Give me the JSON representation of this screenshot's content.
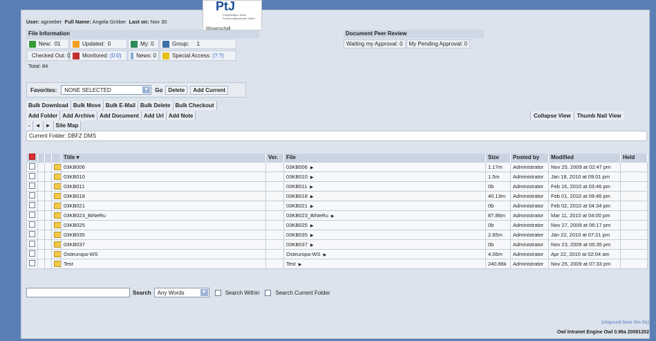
{
  "header": {
    "user_label": "User:",
    "user_value": "agroeber",
    "fullname_label": "Full Name:",
    "fullname_value": "Angela Gröber",
    "lastone_label": "Last on:",
    "lastone_value": "Nov 30"
  },
  "logo": {
    "mark": "PtJ",
    "sub": "Projektträger Jülich Forschungszentrum Jülich",
    "cut": "Wissenschaft"
  },
  "file_info": {
    "title": "File Information",
    "new_label": "New:",
    "new_value": "01",
    "updated_label": "Updated:",
    "updated_value": "0",
    "my_label": "My:",
    "my_value": "0",
    "group_label": "Group:",
    "group_value": "1",
    "checkedout_label": "Checked Out:",
    "checkedout_value": "0",
    "monitored_label": "Monitored:",
    "monitored_value": "(0:0)",
    "news_label": "News:",
    "news_value": "0",
    "special_label": "Special Access:",
    "special_value": "(?:?)",
    "total": "Total: 84"
  },
  "peer_review": {
    "title": "Document Peer Review",
    "waiting": "Waiting my Approval: 0",
    "pending": "My Pending Approval: 0"
  },
  "favorites": {
    "label": "Favorites:",
    "selected": "NONE SELECTED",
    "go": "Go",
    "delete": "Delete",
    "add_current": "Add Current"
  },
  "bulk_bar": [
    "Bulk Download",
    "Bulk Move",
    "Bulk E-Mail",
    "Bulk Delete",
    "Bulk Checkout"
  ],
  "add_bar": [
    "Add Folder",
    "Add Archive",
    "Add Document",
    "Add Url",
    "Add Note"
  ],
  "view_bar": [
    "Collapse View",
    "Thumb Nail View"
  ],
  "nav_bar": {
    "back": "-",
    "prev": "◄",
    "next": "►",
    "sitemap": "Site Map"
  },
  "current_folder": "Current Folder: DBFZ DMS",
  "table": {
    "headers": {
      "title": "Title ▾",
      "ver": "Ver.",
      "file": "File",
      "size": "Size",
      "posted": "Posted by",
      "modified": "Modified",
      "held": "Held"
    },
    "rows": [
      {
        "title": "03KB006",
        "file": "03KB006",
        "size": "1.17m",
        "posted": "Administrator",
        "modified": "Nov 25, 2009 at 02:47 pm"
      },
      {
        "title": "03KB010",
        "file": "03KB010",
        "size": "1.5m",
        "posted": "Administrator",
        "modified": "Jan 18, 2010 at 09:01 pm"
      },
      {
        "title": "03KB011",
        "file": "03KB011",
        "size": "0b",
        "posted": "Administrator",
        "modified": "Feb 16, 2010 at 03:46 pm"
      },
      {
        "title": "03KB018",
        "file": "03KB018",
        "size": "40.13m",
        "posted": "Administrator",
        "modified": "Feb 01, 2010 at 09:46 pm"
      },
      {
        "title": "03KB021",
        "file": "03KB021",
        "size": "0b",
        "posted": "Administrator",
        "modified": "Feb 02, 2010 at 04:34 pm"
      },
      {
        "title": "03KB023_BiNeRu",
        "file": "03KB023_BiNeRu",
        "size": "87.86m",
        "posted": "Administrator",
        "modified": "Mar 11, 2010 at 04:00 pm"
      },
      {
        "title": "03KB025",
        "file": "03KB025",
        "size": "0b",
        "posted": "Administrator",
        "modified": "Nov 27, 2009 at 06:17 pm"
      },
      {
        "title": "03KB035",
        "file": "03KB035",
        "size": "2.65m",
        "posted": "Administrator",
        "modified": "Jan 22, 2010 at 07:21 pm"
      },
      {
        "title": "03KB037",
        "file": "03KB037",
        "size": "0b",
        "posted": "Administrator",
        "modified": "Nov 23, 2009 at 06:35 pm"
      },
      {
        "title": "Osteuropa-WS",
        "file": "Osteuropa-WS",
        "size": "4.06m",
        "posted": "Administrator",
        "modified": "Apr 22, 2010 at 02:04 am"
      },
      {
        "title": "Test",
        "file": "Test",
        "size": "240.86k",
        "posted": "Administrator",
        "modified": "Nov 25, 2009 at 07:33 pm"
      }
    ]
  },
  "search": {
    "button": "Search",
    "mode": "Any Words",
    "within": "Search Within",
    "current": "Search Current Folder"
  },
  "footer": {
    "elapsed": "(elapsed time 0m 0s)",
    "engine": "Owl Intranet Engine Owl 0.96a 20081202"
  }
}
